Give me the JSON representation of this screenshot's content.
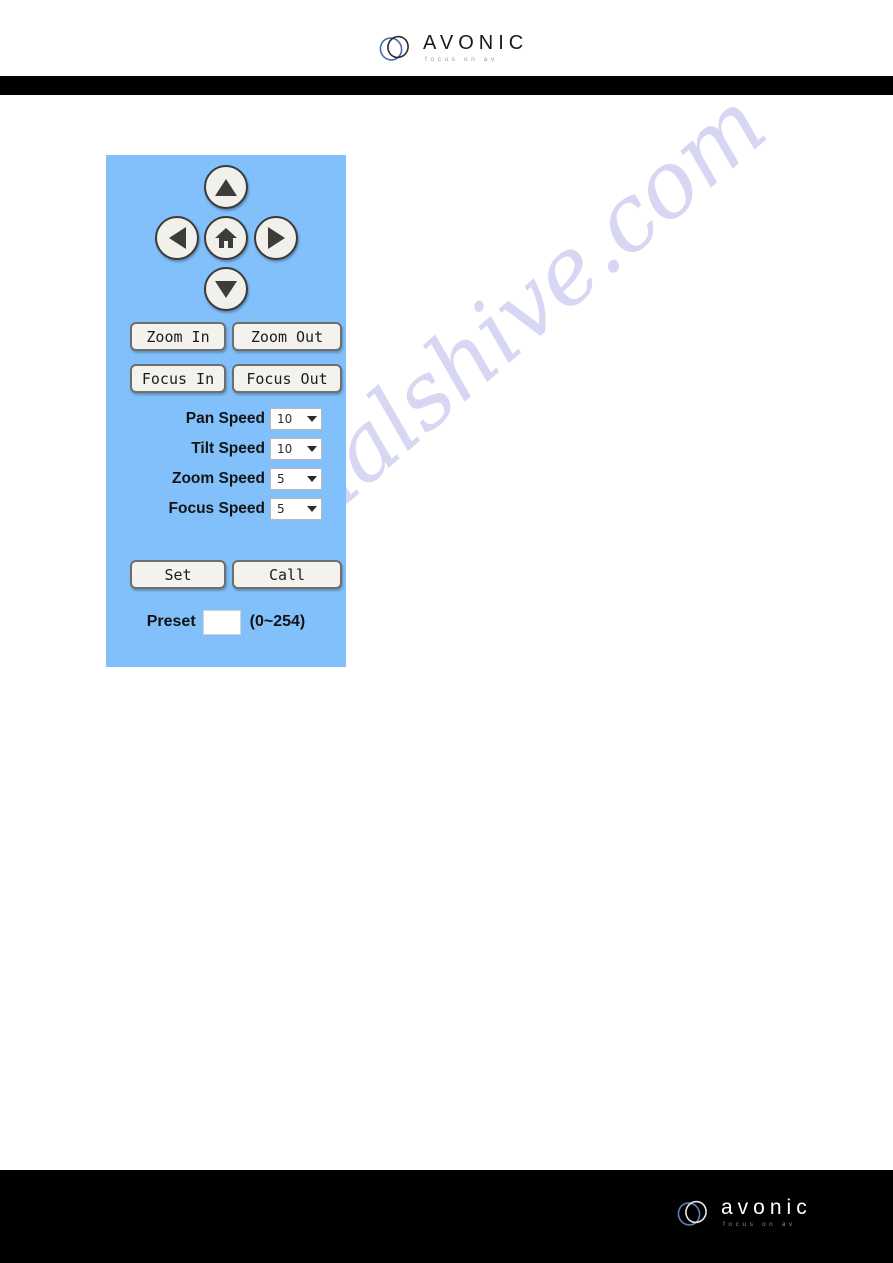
{
  "watermark": {
    "text": "manualshive.com",
    "color": "#d7d7f3"
  },
  "header": {
    "logo_name": "AVONIC",
    "logo_tagline": "focus on av",
    "logo_mark_icon": "avonic-rings-icon",
    "rule_color": "#000000"
  },
  "footer": {
    "logo_name": "avonic",
    "logo_tagline": "focus on av",
    "logo_mark_icon": "avonic-rings-icon",
    "background": "#000000"
  },
  "panel": {
    "background": "#82c0fb",
    "dpad": {
      "up_icon": "triangle-up-icon",
      "left_icon": "triangle-left-icon",
      "home_icon": "home-icon",
      "right_icon": "triangle-right-icon",
      "down_icon": "triangle-down-icon"
    },
    "buttons": {
      "zoom_in": "Zoom In",
      "zoom_out": "Zoom Out",
      "focus_in": "Focus In",
      "focus_out": "Focus Out",
      "set": "Set",
      "call": "Call"
    },
    "speeds": [
      {
        "label": "Pan Speed",
        "value": "10"
      },
      {
        "label": "Tilt Speed",
        "value": "10"
      },
      {
        "label": "Zoom Speed",
        "value": "5"
      },
      {
        "label": "Focus Speed",
        "value": "5"
      }
    ],
    "preset": {
      "label": "Preset",
      "value": "",
      "range": "(0~254)"
    }
  }
}
